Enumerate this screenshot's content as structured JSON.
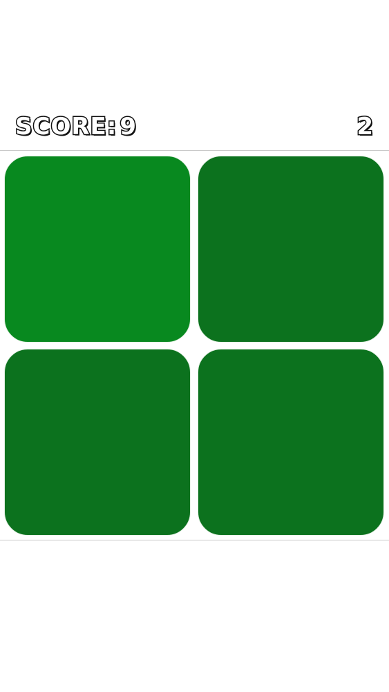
{
  "hud": {
    "score_label": "SCORE:",
    "score_value": "9",
    "level_value": "2"
  },
  "board": {
    "tiles": [
      {
        "color": "#08891f",
        "odd": true
      },
      {
        "color": "#0c721e",
        "odd": false
      },
      {
        "color": "#0c721e",
        "odd": false
      },
      {
        "color": "#0c721e",
        "odd": false
      }
    ]
  }
}
